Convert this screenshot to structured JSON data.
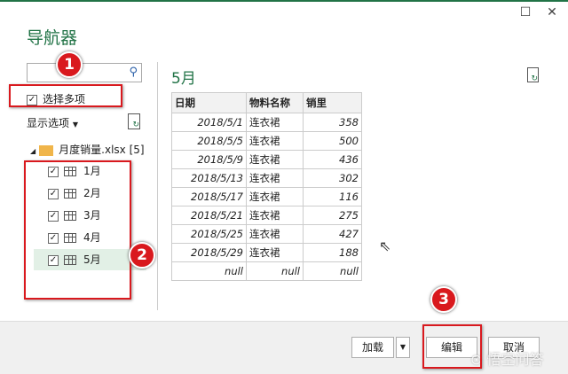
{
  "window": {
    "title": "导航器",
    "maximize_icon": "square-icon",
    "close_icon": "close-icon"
  },
  "left": {
    "search_placeholder": "",
    "multi_select_label": "选择多项",
    "multi_select_checked": true,
    "display_options_label": "显示选项",
    "file_label": "月度销量.xlsx [5]",
    "items": [
      {
        "label": "1月",
        "checked": true
      },
      {
        "label": "2月",
        "checked": true
      },
      {
        "label": "3月",
        "checked": true
      },
      {
        "label": "4月",
        "checked": true
      },
      {
        "label": "5月",
        "checked": true,
        "selected": true
      }
    ]
  },
  "preview": {
    "title": "5月",
    "headers": [
      "日期",
      "物料名称",
      "销里"
    ],
    "rows": [
      [
        "2018/5/1",
        "连衣裙",
        "358"
      ],
      [
        "2018/5/5",
        "连衣裙",
        "500"
      ],
      [
        "2018/5/9",
        "连衣裙",
        "436"
      ],
      [
        "2018/5/13",
        "连衣裙",
        "302"
      ],
      [
        "2018/5/17",
        "连衣裙",
        "116"
      ],
      [
        "2018/5/21",
        "连衣裙",
        "275"
      ],
      [
        "2018/5/25",
        "连衣裙",
        "427"
      ],
      [
        "2018/5/29",
        "连衣裙",
        "188"
      ],
      [
        "null",
        "null",
        "null"
      ]
    ]
  },
  "buttons": {
    "load": "加载",
    "edit": "编辑",
    "cancel": "取消"
  },
  "annotations": [
    "1",
    "2",
    "3"
  ],
  "watermark": "悟空问答",
  "colors": {
    "accent": "#217346",
    "annotation": "#d9191e"
  }
}
